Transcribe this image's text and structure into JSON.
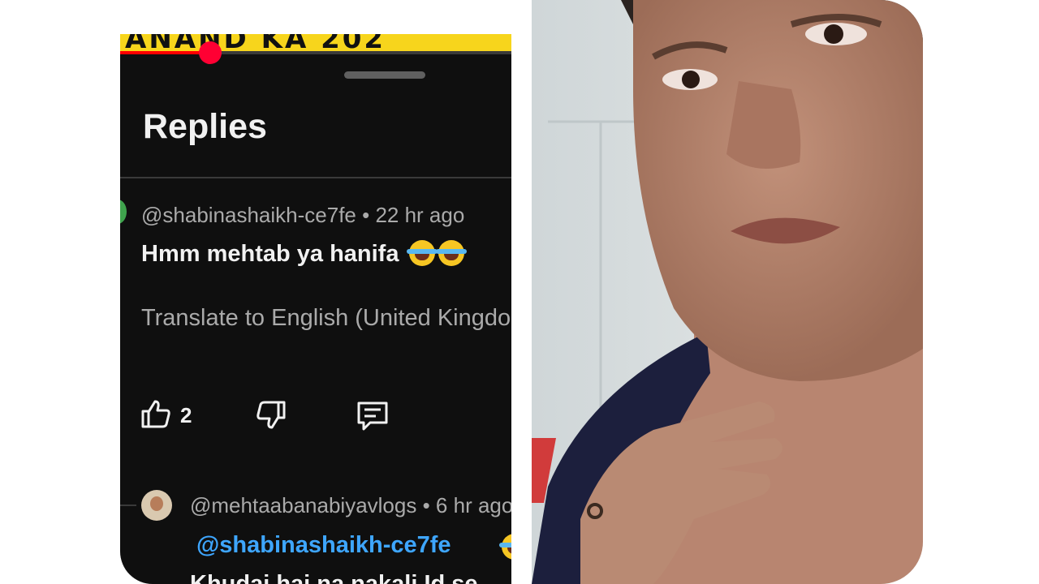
{
  "video": {
    "banner_text": "ANAND KA 202",
    "progress": 0.23
  },
  "replies_panel": {
    "title": "Replies",
    "comments": [
      {
        "handle": "@shabinashaikh-ce7fe",
        "time": "• 22 hr ago",
        "text": "Hmm mehtab ya hanifa",
        "translate_label": "Translate to English (United Kingdom)",
        "likes": "2"
      },
      {
        "handle": "@mehtaabanabiyavlogs",
        "time": "• 6 hr ago",
        "mention": "@shabinashaikh-ce7fe",
        "text": "Khudai hai na nakali Id se"
      }
    ]
  },
  "icons": [
    "thumbs-up-icon",
    "thumbs-down-icon",
    "reply-comment-icon",
    "laughing-emoji-icon"
  ],
  "colors": {
    "panel_background": "#0f0f0f",
    "progress_red": "#ff0033",
    "banner_yellow": "#f7d51c",
    "mention_blue": "#3ea6ff",
    "muted_text": "#aaaaaa"
  }
}
